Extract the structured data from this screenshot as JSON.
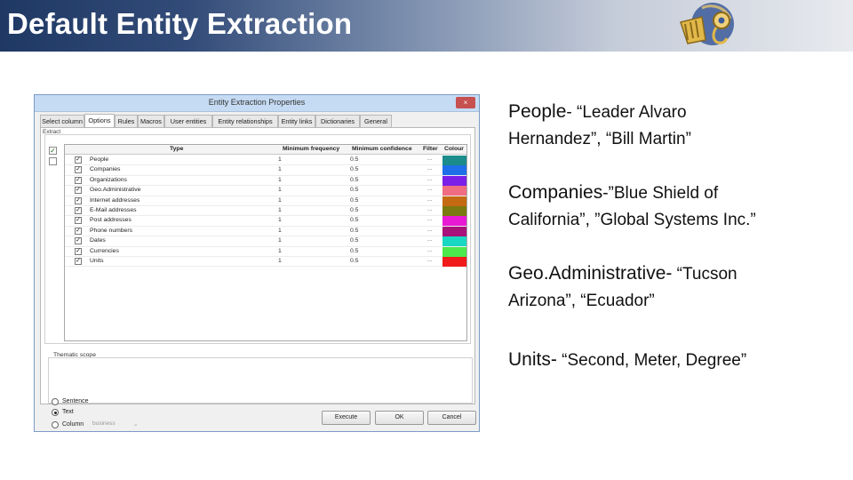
{
  "slide": {
    "title": "Default Entity Extraction"
  },
  "dialog": {
    "title": "Entity Extraction Properties",
    "close_label": "×",
    "tabs": [
      "Select column",
      "Options",
      "Rules",
      "Macros",
      "User entities",
      "Entity relationships",
      "Entity links",
      "Dictionaries",
      "General"
    ],
    "active_tab": "Options",
    "extract_label": "Extract",
    "columns": {
      "type": "Type",
      "min_frequency": "Minimum frequency",
      "min_confidence": "Minimum confidence",
      "filter": "Filter",
      "colour": "Colour"
    },
    "rows": [
      {
        "type": "People",
        "freq": "1",
        "conf": "0.5",
        "filter": "...",
        "color": "#1a8c8c",
        "checked": "✓"
      },
      {
        "type": "Companies",
        "freq": "1",
        "conf": "0.5",
        "filter": "...",
        "color": "#1f6fe8",
        "checked": "✓"
      },
      {
        "type": "Organizations",
        "freq": "1",
        "conf": "0.5",
        "filter": "...",
        "color": "#7a1fe8",
        "checked": "✓"
      },
      {
        "type": "Geo.Administrative",
        "freq": "1",
        "conf": "0.5",
        "filter": "...",
        "color": "#f06c80",
        "checked": "✓"
      },
      {
        "type": "Internet addresses",
        "freq": "1",
        "conf": "0.5",
        "filter": "...",
        "color": "#c46a12",
        "checked": "✓"
      },
      {
        "type": "E-Mail addresses",
        "freq": "1",
        "conf": "0.5",
        "filter": "...",
        "color": "#7a7a10",
        "checked": "✓"
      },
      {
        "type": "Post addresses",
        "freq": "1",
        "conf": "0.5",
        "filter": "...",
        "color": "#e81ad4",
        "checked": "✓"
      },
      {
        "type": "Phone numbers",
        "freq": "1",
        "conf": "0.5",
        "filter": "...",
        "color": "#a8127a",
        "checked": "✓"
      },
      {
        "type": "Dates",
        "freq": "1",
        "conf": "0.5",
        "filter": "...",
        "color": "#18d8c4",
        "checked": "✓"
      },
      {
        "type": "Currencies",
        "freq": "1",
        "conf": "0.5",
        "filter": "...",
        "color": "#4ce84c",
        "checked": "✓"
      },
      {
        "type": "Units",
        "freq": "1",
        "conf": "0.5",
        "filter": "...",
        "color": "#f01a1a",
        "checked": "✓"
      }
    ],
    "thematic_scope": {
      "label": "Thematic scope",
      "options": [
        "Sentence",
        "Text",
        "Column"
      ],
      "selected": "Text",
      "column_value": "business"
    },
    "buttons": {
      "execute": "Execute",
      "ok": "OK",
      "cancel": "Cancel"
    }
  },
  "bullets": [
    {
      "key": "People",
      "lines": [
        "- “Leader Alvaro",
        "Hernandez”, “Bill Martin”"
      ]
    },
    {
      "key": "Companies",
      "lines": [
        "-”Blue Shield of",
        "California”, ”Global Systems Inc.”"
      ]
    },
    {
      "key": "Geo.Administrative-",
      "lines": [
        " “Tucson",
        "Arizona”, “Ecuador”"
      ]
    },
    {
      "key": "Units-",
      "lines": [
        " “Second, Meter, Degree”"
      ]
    }
  ]
}
